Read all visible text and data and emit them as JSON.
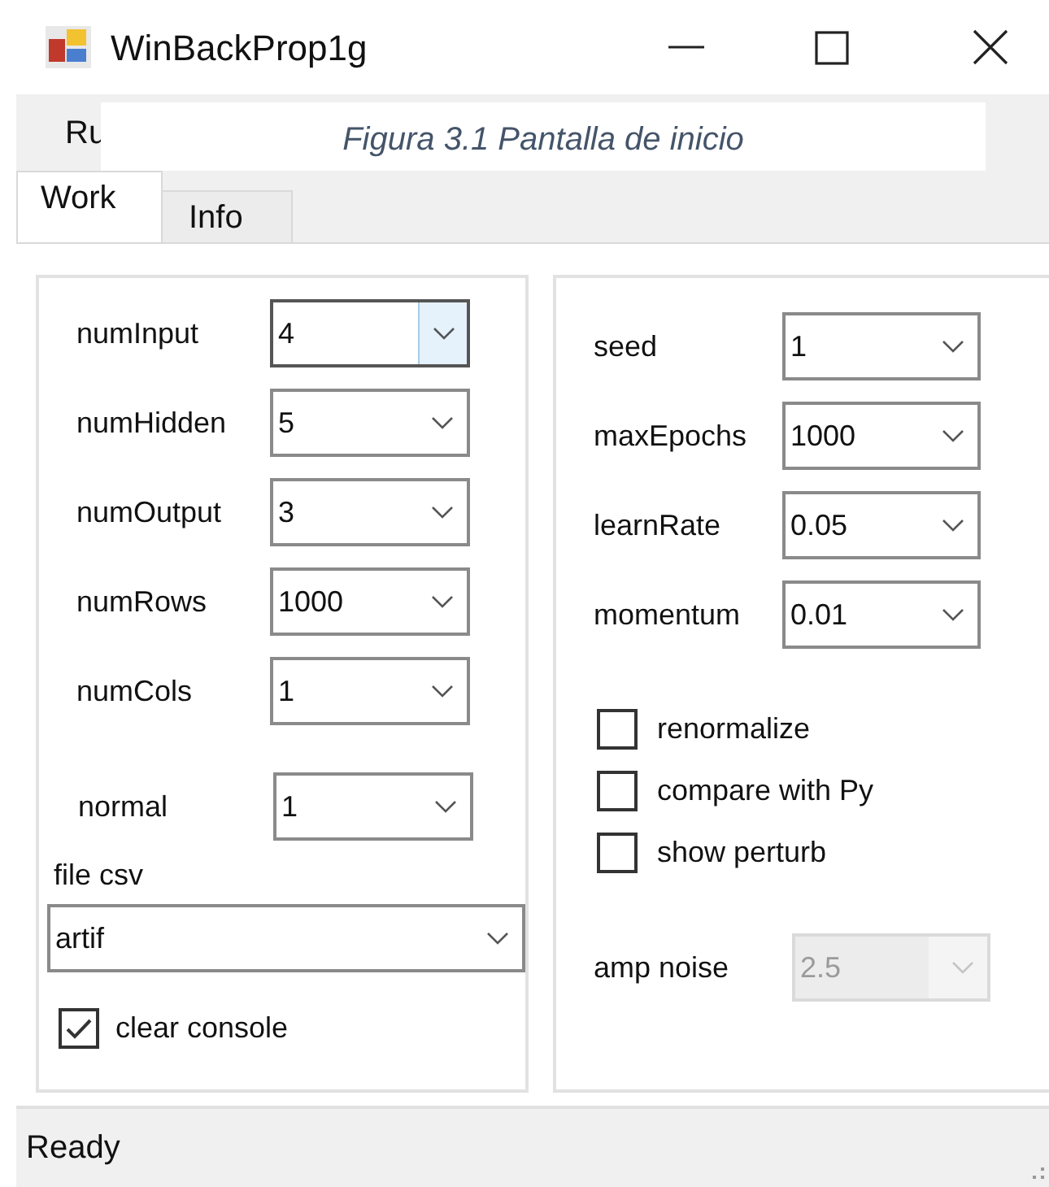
{
  "window": {
    "title": "WinBackProp1g"
  },
  "menu": [
    {
      "label": "Ru"
    }
  ],
  "caption": "Figura 3.1 Pantalla de inicio",
  "tabs": [
    {
      "label": "Work",
      "selected": true
    },
    {
      "label": "Info",
      "selected": false
    }
  ],
  "left_fields": [
    {
      "label": "numInput",
      "value": "4",
      "focused": true
    },
    {
      "label": "numHidden",
      "value": "5",
      "focused": false
    },
    {
      "label": "numOutput",
      "value": "3",
      "focused": false
    },
    {
      "label": "numRows",
      "value": "1000",
      "focused": false
    },
    {
      "label": "numCols",
      "value": "1",
      "focused": false
    }
  ],
  "normal": {
    "label": "normal",
    "value": "1"
  },
  "file_csv": {
    "label": "file csv",
    "value": "artif"
  },
  "clear_console": {
    "label": "clear console",
    "checked": true
  },
  "right_fields": [
    {
      "label": "seed",
      "value": "1"
    },
    {
      "label": "maxEpochs",
      "value": "1000"
    },
    {
      "label": "learnRate",
      "value": "0.05"
    },
    {
      "label": "momentum",
      "value": "0.01"
    }
  ],
  "options": [
    {
      "label": "renormalize",
      "checked": false
    },
    {
      "label": "compare with Py",
      "checked": false
    },
    {
      "label": "show perturb",
      "checked": false
    }
  ],
  "amp_noise": {
    "label": "amp noise",
    "value": "2.5",
    "disabled": true
  },
  "status_bar": "Ready"
}
